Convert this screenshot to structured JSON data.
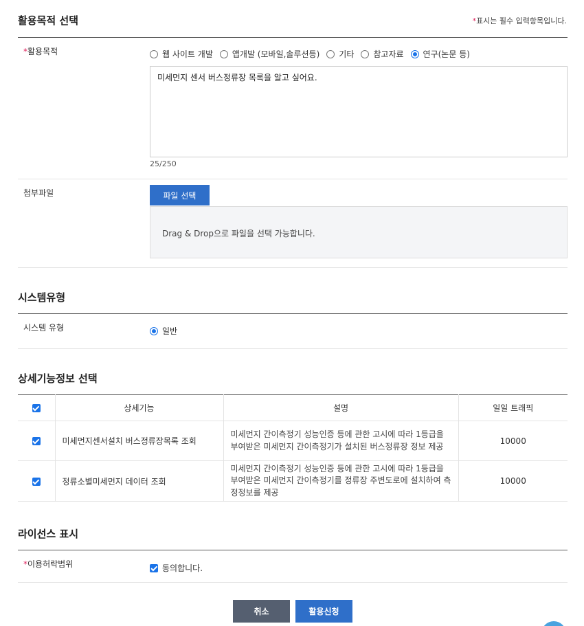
{
  "purpose": {
    "title": "활용목적 선택",
    "required_star": "*",
    "required_note": "표시는 필수 입력항목입니다.",
    "label": "활용목적",
    "options": [
      "웹 사이트 개발",
      "앱개발 (모바일,솔루션등)",
      "기타",
      "참고자료",
      "연구(논문 등)"
    ],
    "selected": "연구(논문 등)",
    "text": "미세먼지 센서 버스정류장 목록을 알고 싶어요.",
    "counter": "25/250"
  },
  "attachment": {
    "label": "첨부파일",
    "button": "파일 선택",
    "dropzone": "Drag & Drop으로 파일을 선택 가능합니다."
  },
  "system": {
    "title": "시스템유형",
    "label": "시스템 유형",
    "option": "일반"
  },
  "features": {
    "title": "상세기능정보 선택",
    "headers": [
      "상세기능",
      "설명",
      "일일 트래픽"
    ],
    "rows": [
      {
        "name": "미세먼지센서설치 버스정류장목록 조회",
        "description": "미세먼지 간이측정기 성능인증 등에 관한 고시에 따라 1등급을 부여받은 미세먼지 간이측정기가 설치된 버스정류장 정보 제공",
        "traffic": "10000"
      },
      {
        "name": "정류소별미세먼지 데이터 조회",
        "description": "미세먼지 간이측정기 성능인증 등에 관한 고시에 따라 1등급을 부여받은 미세먼지 간이측정기를 정류장 주변도로에 설치하여 측정정보를 제공",
        "traffic": "10000"
      }
    ]
  },
  "license": {
    "title": "라이선스 표시",
    "label": "이용허락범위",
    "agree": "동의합니다."
  },
  "actions": {
    "cancel": "취소",
    "apply": "활용신청"
  },
  "colors": {
    "primary": "#2f6fc9",
    "checkbox": "#1a73e8",
    "cancel": "#555f70",
    "required": "#e0245e"
  }
}
